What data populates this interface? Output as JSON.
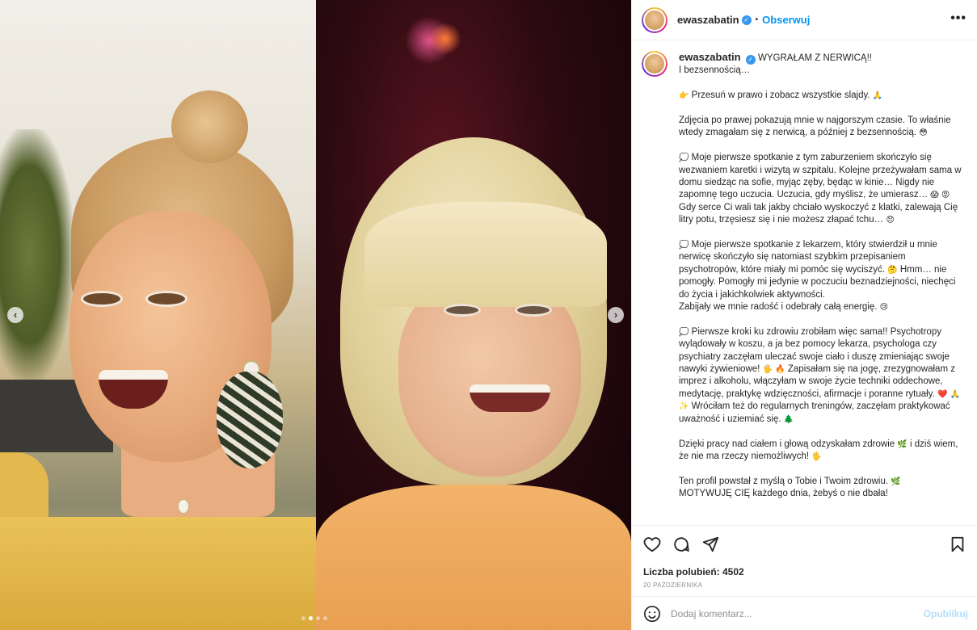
{
  "post": {
    "username": "ewaszabatin",
    "verified_icon": "verified-badge-icon",
    "follow_label": "Obserwuj",
    "separator": "•",
    "more_label": "•••"
  },
  "caption": {
    "title": "WYGRAŁAM Z NERWICĄ!!",
    "lines": [
      "I bezsennością…",
      "",
      "Przesuń w prawo i zobacz wszystkie slajdy.",
      "",
      "Zdjęcia po prawej pokazują mnie w najgorszym czasie. To właśnie wtedy zmagałam się z nerwicą, a później z bezsennością.",
      "",
      "Moje pierwsze spotkanie z tym zaburzeniem skończyło się wezwaniem karetki i wizytą w szpitalu. Kolejne przeżywałam sama w domu siedząc na sofie, myjąc zęby, będąc w kinie… Nigdy nie zapomnę tego uczucia. Uczucia, gdy myślisz, że umierasz…",
      "Gdy serce Ci wali tak jakby chciało wyskoczyć z klatki, zalewają Cię litry potu, trzęsiesz się i nie możesz złapać tchu…",
      "",
      "Moje pierwsze spotkanie z lekarzem, który stwierdził u mnie nerwicę skończyło się natomiast szybkim przepisaniem psychotropów, które miały mi pomóc się wyciszyć.",
      "Hmm… nie pomogły. Pomogły mi jedynie w poczuciu beznadziejności, niechęci do życia i jakichkolwiek aktywności.",
      "Zabijały we mnie radość i odebrały całą energię.",
      "",
      "Pierwsze kroki ku zdrowiu zrobiłam więc sama!! Psychotropy wylądowały w koszu, a ja bez pomocy lekarza, psychologa czy psychiatry zaczęłam uleczać swoje ciało i duszę zmieniając swoje nawyki żywieniowe!",
      "Zapisałam się na jogę, zrezygnowałam z imprez i alkoholu, włączyłam w swoje życie techniki oddechowe, medytację, praktykę wdzięczności, afirmacje i poranne rytuały.",
      "Wróciłam też do regularnych treningów, zaczęłam praktykować uważność i uziemiać się.",
      "",
      "Dzięki pracy nad ciałem i głową odzyskałam zdrowie",
      "i dziś wiem, że nie ma rzeczy niemożliwych!",
      "",
      "Ten profil powstał z myślą o Tobie i Twoim zdrowiu.",
      "MOTYWUJĘ CIĘ każdego dnia, żebyś o nie dbała!"
    ]
  },
  "actions": {
    "likes_text": "Liczba polubień: 4502",
    "date_text": "20 PAŹDZIERNIKA",
    "comment_placeholder": "Dodaj komentarz...",
    "publish_label": "Opublikuj"
  },
  "carousel": {
    "slide_count": 4,
    "active_index": 1,
    "prev_label": "‹",
    "next_label": "›"
  },
  "emoji": {
    "point_right": "👉",
    "pray": "🙏",
    "flushed": "😳",
    "speech": "💭",
    "scream": "😱",
    "angry": "😡",
    "disappointed": "😞",
    "thinking": "🤔",
    "sad": "😢",
    "hand": "🖐",
    "fire": "🔥",
    "heart": "❤️",
    "sparkles": "✨",
    "tree": "🌲",
    "leaf": "🌿"
  }
}
